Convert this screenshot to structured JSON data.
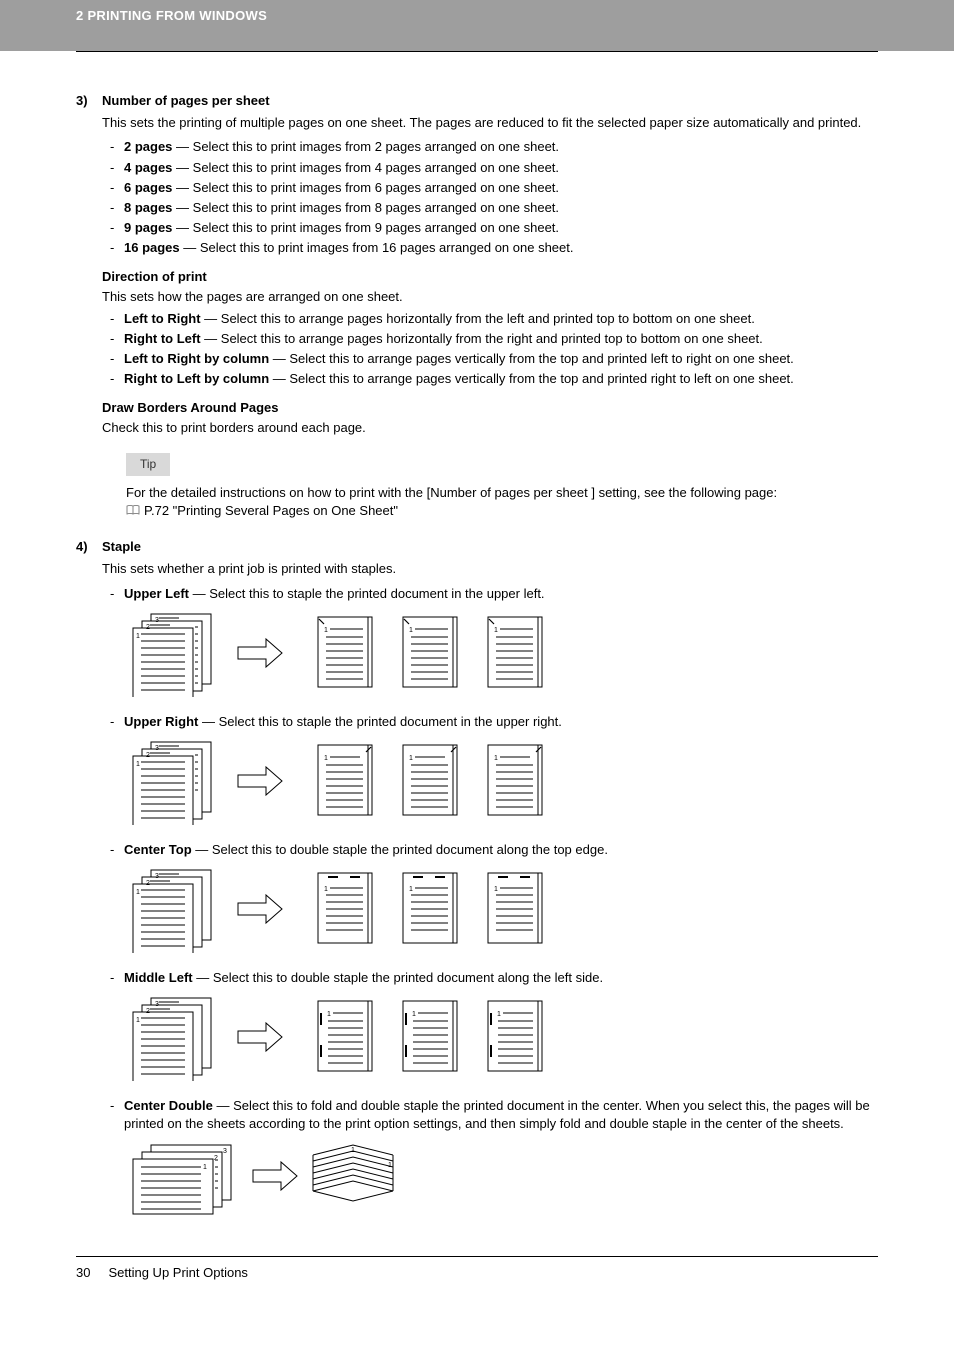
{
  "header": {
    "chapter": "2 PRINTING FROM WINDOWS"
  },
  "section3": {
    "number": "3)",
    "title": "Number of pages per sheet",
    "desc": "This sets the printing of multiple pages on one sheet. The pages are reduced to fit the selected paper size automatically and printed.",
    "options": [
      {
        "name": "2 pages",
        "desc": " — Select this to print images from 2 pages arranged on one sheet."
      },
      {
        "name": "4 pages",
        "desc": " — Select this to print images from 4 pages arranged on one sheet."
      },
      {
        "name": "6 pages",
        "desc": " — Select this to print images from 6 pages arranged on one sheet."
      },
      {
        "name": "8 pages",
        "desc": " — Select this to print images from 8 pages arranged on one sheet."
      },
      {
        "name": "9 pages",
        "desc": " — Select this to print images from 9 pages arranged on one sheet."
      },
      {
        "name": "16 pages",
        "desc": " — Select this to print images from 16 pages arranged on one sheet."
      }
    ],
    "direction": {
      "title": "Direction of print",
      "desc": "This sets how the pages are arranged on one sheet.",
      "options": [
        {
          "name": "Left to Right",
          "desc": " — Select this to arrange pages horizontally from the left and printed top to bottom on one sheet."
        },
        {
          "name": "Right to Left",
          "desc": " — Select this to arrange pages horizontally from the right and printed top to bottom on one sheet."
        },
        {
          "name": "Left to Right by column",
          "desc": " — Select this to arrange pages vertically from the top and printed left to right on one sheet."
        },
        {
          "name": "Right to Left by column",
          "desc": " — Select this to arrange pages vertically from the top and printed right to left on one sheet."
        }
      ]
    },
    "borders": {
      "title": "Draw Borders Around Pages",
      "desc": "Check this to print borders around each page."
    },
    "tip": {
      "label": "Tip",
      "line1": "For the detailed instructions on how to print with the [Number of pages per sheet ] setting, see the following page:",
      "line2": "P.72 \"Printing Several Pages on One Sheet\""
    }
  },
  "section4": {
    "number": "4)",
    "title": "Staple",
    "desc": "This sets whether a print job is printed with staples.",
    "options": [
      {
        "name": "Upper Left",
        "desc": " — Select this to staple the printed document in the upper left."
      },
      {
        "name": "Upper Right",
        "desc": " — Select this to staple the printed document in the upper right."
      },
      {
        "name": "Center Top",
        "desc": " — Select this to double staple the printed document along the top edge."
      },
      {
        "name": "Middle Left",
        "desc": " — Select this to double staple the printed document along the left side."
      },
      {
        "name": "Center Double",
        "desc": " — Select this to fold and double staple the printed document in the center.  When you select this, the pages will be printed on the sheets according to the print option settings, and then simply fold and double staple in the center of the sheets."
      }
    ]
  },
  "footer": {
    "pageNum": "30",
    "title": "Setting Up Print Options"
  }
}
